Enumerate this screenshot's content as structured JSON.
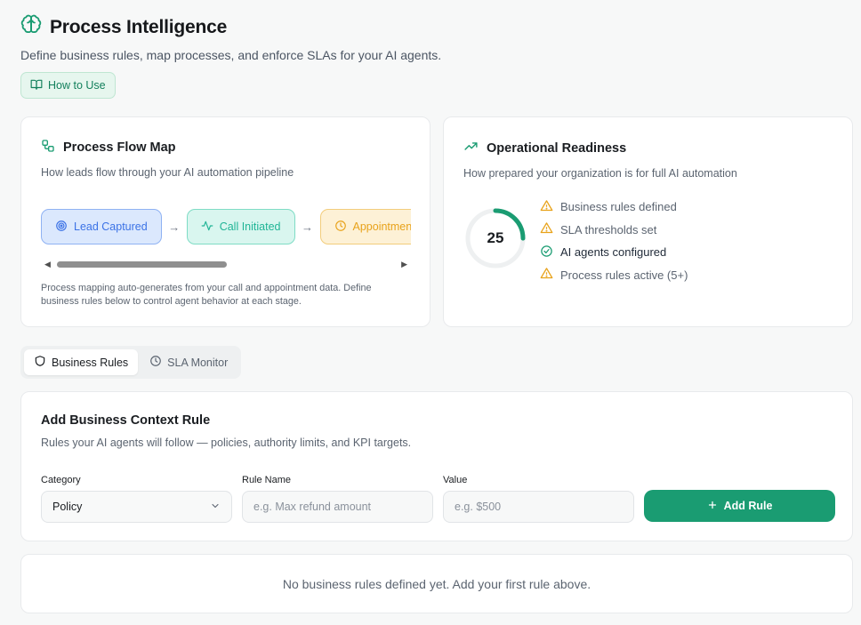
{
  "header": {
    "title": "Process Intelligence",
    "subtitle": "Define business rules, map processes, and enforce SLAs for your AI agents.",
    "how_to_label": "How to Use",
    "icon": "brain-icon"
  },
  "flow_card": {
    "title": "Process Flow Map",
    "subtitle": "How leads flow through your AI automation pipeline",
    "nodes": [
      {
        "label": "Lead Captured",
        "icon": "target-icon",
        "color": "#3b72e6"
      },
      {
        "label": "Call Initiated",
        "icon": "activity-icon",
        "color": "#20b596"
      },
      {
        "label": "Appointment",
        "icon": "clock-icon",
        "color": "#e8a21a"
      }
    ],
    "note": "Process mapping auto-generates from your call and appointment data. Define business rules below to control agent behavior at each stage."
  },
  "readiness_card": {
    "title": "Operational Readiness",
    "subtitle": "How prepared your organization is for full AI automation",
    "score": "25",
    "score_fraction": 0.25,
    "items": [
      {
        "label": "Business rules defined",
        "status": "warning"
      },
      {
        "label": "SLA thresholds set",
        "status": "warning"
      },
      {
        "label": "AI agents configured",
        "status": "done"
      },
      {
        "label": "Process rules active (5+)",
        "status": "warning"
      }
    ]
  },
  "tabs": [
    {
      "label": "Business Rules",
      "icon": "shield-icon",
      "active": true
    },
    {
      "label": "SLA Monitor",
      "icon": "clock-icon",
      "active": false
    }
  ],
  "rule_form": {
    "title": "Add Business Context Rule",
    "subtitle": "Rules your AI agents will follow — policies, authority limits, and KPI targets.",
    "category_label": "Category",
    "category_value": "Policy",
    "rule_name_label": "Rule Name",
    "rule_name_placeholder": "e.g. Max refund amount",
    "value_label": "Value",
    "value_placeholder": "e.g. $500",
    "add_button_label": "Add Rule"
  },
  "empty_state": {
    "text": "No business rules defined yet. Add your first rule above."
  },
  "colors": {
    "accent": "#1a9c72",
    "warning": "#e8a21a"
  }
}
